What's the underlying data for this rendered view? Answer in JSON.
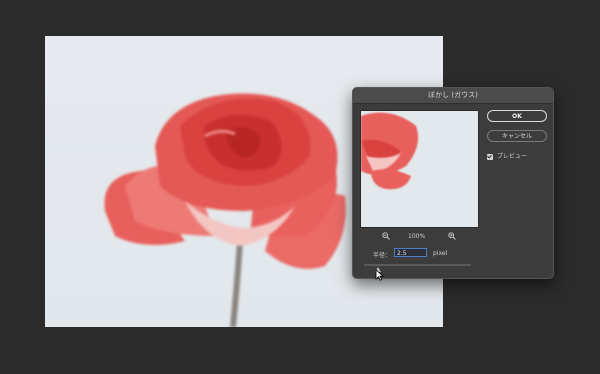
{
  "dialog": {
    "title": "ぼかし (ガウス)",
    "ok_label": "OK",
    "cancel_label": "キャンセル",
    "preview_label": "プレビュー",
    "preview_checked": true,
    "zoom_level": "100%",
    "radius_label": "半径：",
    "radius_value": "2.5",
    "radius_unit": "pixel"
  },
  "colors": {
    "rose": "#e8524f",
    "rose_dark": "#c8302f",
    "background": "#e4e9ed",
    "workspace": "#2b2b2b"
  },
  "icons": {
    "zoom_out": "zoom-out-icon",
    "zoom_in": "zoom-in-icon",
    "cursor": "arrow-cursor-icon"
  }
}
